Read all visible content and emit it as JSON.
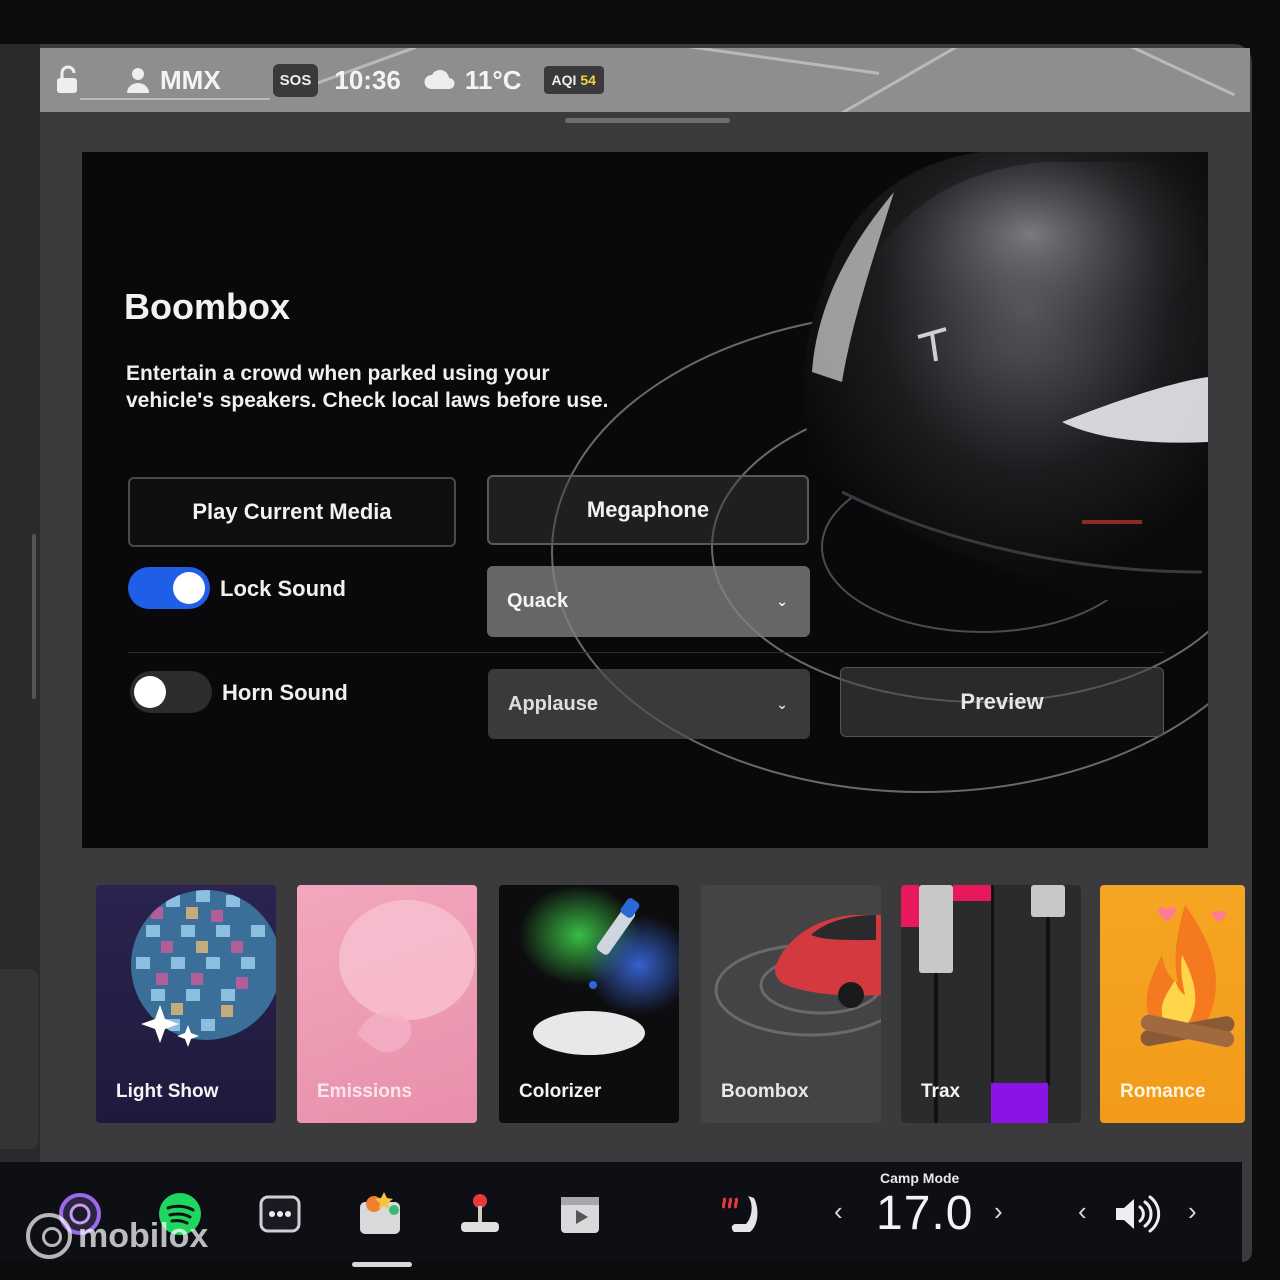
{
  "status_bar": {
    "profile_name": "MMX",
    "sos_label": "SOS",
    "time": "10:36",
    "temperature": "11°C",
    "aqi_label": "AQI",
    "aqi_value": "54"
  },
  "boombox": {
    "title": "Boombox",
    "description": "Entertain a crowd when parked using your vehicle's speakers. Check local laws before use.",
    "play_media_label": "Play Current Media",
    "megaphone_label": "Megaphone",
    "lock_sound_label": "Lock Sound",
    "lock_sound_on": true,
    "lock_sound_selected": "Quack",
    "horn_sound_label": "Horn Sound",
    "horn_sound_on": false,
    "horn_sound_selected": "Applause",
    "preview_label": "Preview"
  },
  "tiles": [
    {
      "label": "Light Show"
    },
    {
      "label": "Emissions"
    },
    {
      "label": "Colorizer"
    },
    {
      "label": "Boombox"
    },
    {
      "label": "Trax"
    },
    {
      "label": "Romance"
    }
  ],
  "dock": {
    "climate_mode_label": "Camp Mode",
    "temperature_setting": "17.0",
    "icons": [
      "camera-icon",
      "spotify-icon",
      "more-apps-icon",
      "toybox-icon",
      "joystick-icon",
      "theater-icon",
      "seat-heater-icon",
      "volume-icon"
    ]
  },
  "watermark": "mobilox",
  "colors": {
    "toggle_on": "#1f5fe8",
    "aqi_value": "#f2d53c",
    "romance_tile": "#f5a623",
    "emissions_tile": "#f3a7bd"
  }
}
